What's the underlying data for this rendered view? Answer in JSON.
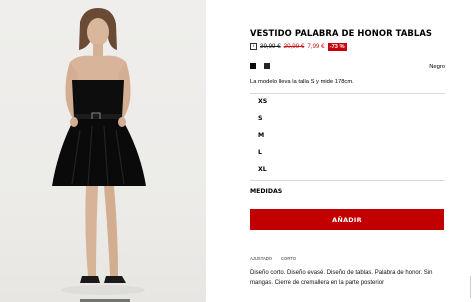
{
  "product": {
    "title": "VESTIDO PALABRA DE HONOR TABLAS",
    "info_icon_name": "info-icon",
    "price_original": "39,99 €",
    "price_previous": "20,99 €",
    "price_current": "7,99 €",
    "discount_badge": "-73 %",
    "colors": [
      {
        "name": "Negro",
        "hex": "#0a0a0a"
      },
      {
        "name": "",
        "hex": "#2b2320"
      }
    ],
    "selected_color": "Negro",
    "model_note": "La modelo lleva la talla S y mide 178cm.",
    "sizes": [
      "XS",
      "S",
      "M",
      "L",
      "XL"
    ],
    "measurements_label": "MEDIDAS",
    "add_button_label": "AÑADIR",
    "tags": [
      "AJUSTADO",
      "CORTO"
    ],
    "description": "Diseño corto. Diseño evasé. Diseño de tablas. Palabra de honor. Sin mangas. Cierre de cremallera en la parte posterior"
  },
  "accent_colors": {
    "sale_red": "#c81313",
    "button_red": "#c20000"
  }
}
